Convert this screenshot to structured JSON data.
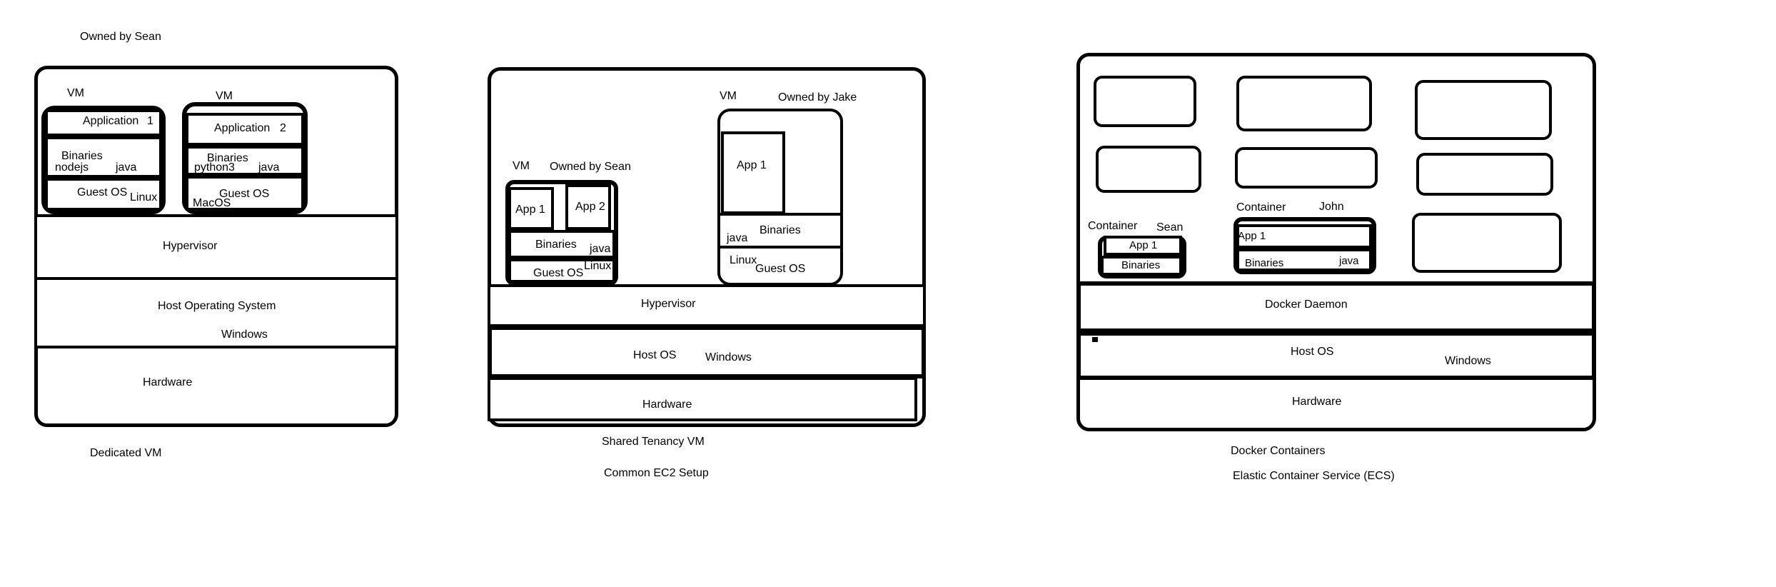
{
  "diagram1": {
    "owner_label": "Owned by Sean",
    "vm1": {
      "label": "VM",
      "app": "Application",
      "app_num": "1",
      "binaries": "Binaries",
      "lang_a": "nodejs",
      "lang_b": "java",
      "guest_os": "Guest OS",
      "os": "Linux"
    },
    "vm2": {
      "label": "VM",
      "app": "Application",
      "app_num": "2",
      "binaries": "Binaries",
      "lang_a": "python3",
      "lang_b": "java",
      "guest_os": "Guest OS",
      "os": "MacOS"
    },
    "hypervisor": "Hypervisor",
    "host_os": "Host Operating System",
    "host_os_name": "Windows",
    "hardware": "Hardware",
    "caption": "Dedicated  VM"
  },
  "diagram2": {
    "vm1": {
      "label": "VM",
      "owner": "Owned by Sean",
      "app1": "App 1",
      "app2": "App 2",
      "binaries": "Binaries",
      "lang": "java",
      "guest_os": "Guest OS",
      "os": "Linux"
    },
    "vm2": {
      "label": "VM",
      "owner": "Owned by Jake",
      "app1": "App 1",
      "binaries": "Binaries",
      "lang": "java",
      "os": "Linux",
      "guest_os": "Guest OS"
    },
    "hypervisor": "Hypervisor",
    "host_os": "Host OS",
    "host_os_name": "Windows",
    "hardware": "Hardware",
    "caption": "Shared Tenancy VM",
    "subcaption": "Common EC2 Setup"
  },
  "diagram3": {
    "container1": {
      "label": "Container",
      "owner": "Sean",
      "app": "App 1",
      "binaries": "Binaries"
    },
    "container2": {
      "label": "Container",
      "owner": "John",
      "app": "App 1",
      "binaries": "Binaries",
      "lang": "java"
    },
    "docker_daemon": "Docker Daemon",
    "host_os": "Host OS",
    "host_os_name": "Windows",
    "hardware": "Hardware",
    "caption": "Docker Containers",
    "subcaption": "Elastic Container Service (ECS)"
  }
}
